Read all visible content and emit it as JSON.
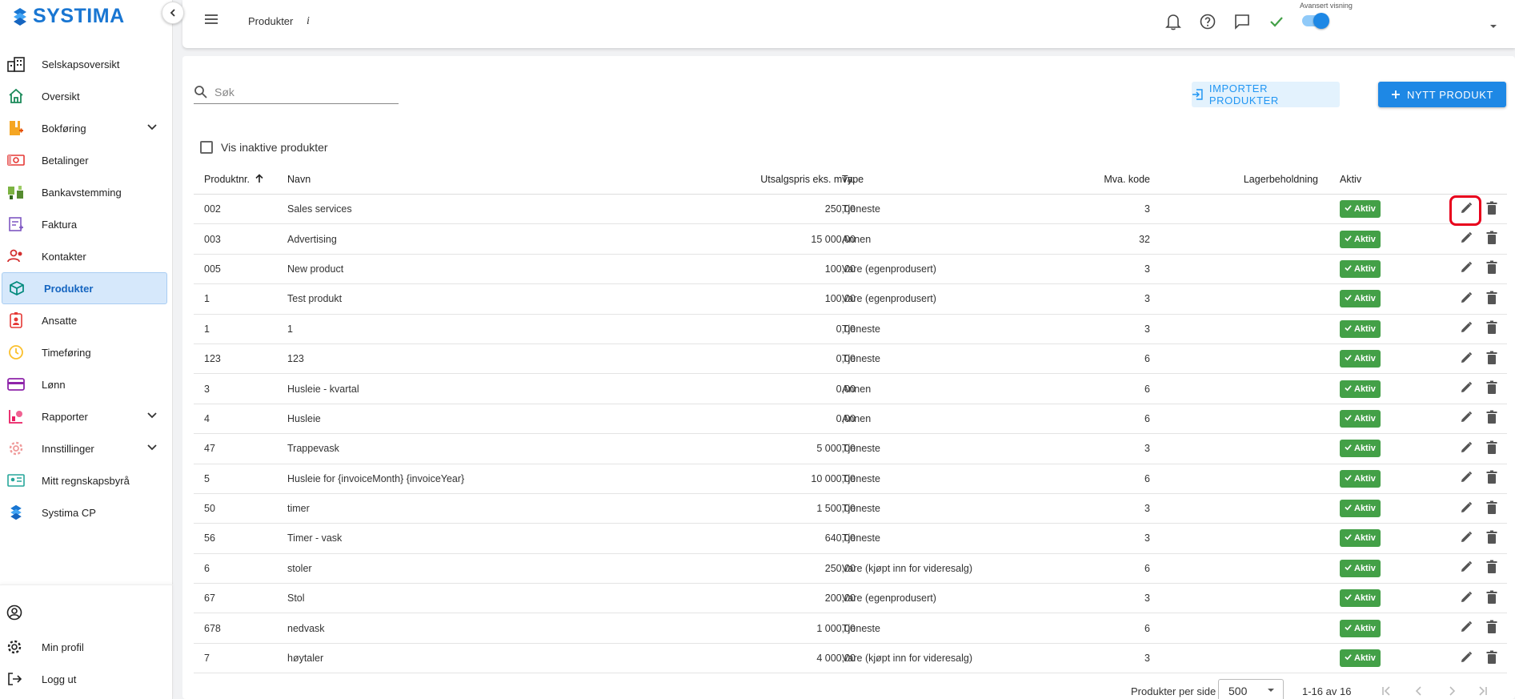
{
  "brand": {
    "name": "SYSTIMA",
    "color": "#1976d2"
  },
  "sidebar": {
    "items": [
      {
        "label": "Selskapsoversikt",
        "icon": "building-icon"
      },
      {
        "label": "Oversikt",
        "icon": "home-icon"
      },
      {
        "label": "Bokføring",
        "icon": "bookkeeping-icon",
        "expandable": true
      },
      {
        "label": "Betalinger",
        "icon": "payments-icon"
      },
      {
        "label": "Bankavstemming",
        "icon": "bank-reconciliation-icon"
      },
      {
        "label": "Faktura",
        "icon": "invoice-icon"
      },
      {
        "label": "Kontakter",
        "icon": "contacts-icon"
      },
      {
        "label": "Produkter",
        "icon": "product-box-icon",
        "active": true
      },
      {
        "label": "Ansatte",
        "icon": "employees-icon"
      },
      {
        "label": "Timeføring",
        "icon": "clock-icon"
      },
      {
        "label": "Lønn",
        "icon": "salary-card-icon"
      },
      {
        "label": "Rapporter",
        "icon": "reports-icon",
        "expandable": true
      },
      {
        "label": "Innstillinger",
        "icon": "settings-gear-icon",
        "expandable": true
      },
      {
        "label": "Mitt regnskapsbyrå",
        "icon": "accounting-firm-icon"
      },
      {
        "label": "Systima CP",
        "icon": "systima-logo-icon"
      }
    ],
    "bottom": {
      "profile_label": "Min profil",
      "logout_label": "Logg ut"
    }
  },
  "header": {
    "title": "Produkter",
    "info": "i",
    "advanced_view_label": "Avansert visning",
    "advanced_view_on": true
  },
  "toolbar": {
    "search_placeholder": "Søk",
    "import_label": "IMPORTER PRODUKTER",
    "new_label": "NYTT PRODUKT",
    "show_inactive_label": "Vis inaktive produkter",
    "show_inactive_checked": false
  },
  "table": {
    "headers": {
      "nr": "Produktnr.",
      "name": "Navn",
      "price": "Utsalgspris eks. mva.",
      "type": "Type",
      "mva": "Mva. kode",
      "stock": "Lagerbeholdning",
      "active": "Aktiv"
    },
    "active_badge": "Aktiv",
    "rows": [
      {
        "nr": "002",
        "name": "Sales services",
        "price": "250,00",
        "type": "Tjeneste",
        "mva": "3",
        "stock": "",
        "active": true
      },
      {
        "nr": "003",
        "name": "Advertising",
        "price": "15 000,00",
        "type": "Annen",
        "mva": "32",
        "stock": "",
        "active": true
      },
      {
        "nr": "005",
        "name": "New product",
        "price": "100,00",
        "type": "Vare (egenprodusert)",
        "mva": "3",
        "stock": "",
        "active": true
      },
      {
        "nr": "1",
        "name": "Test produkt",
        "price": "100,00",
        "type": "Vare (egenprodusert)",
        "mva": "3",
        "stock": "",
        "active": true
      },
      {
        "nr": "1",
        "name": "1",
        "price": "0,00",
        "type": "Tjeneste",
        "mva": "3",
        "stock": "",
        "active": true
      },
      {
        "nr": "123",
        "name": "123",
        "price": "0,00",
        "type": "Tjeneste",
        "mva": "6",
        "stock": "",
        "active": true
      },
      {
        "nr": "3",
        "name": "Husleie - kvartal",
        "price": "0,00",
        "type": "Annen",
        "mva": "6",
        "stock": "",
        "active": true
      },
      {
        "nr": "4",
        "name": "Husleie",
        "price": "0,00",
        "type": "Annen",
        "mva": "6",
        "stock": "",
        "active": true
      },
      {
        "nr": "47",
        "name": "Trappevask",
        "price": "5 000,00",
        "type": "Tjeneste",
        "mva": "3",
        "stock": "",
        "active": true
      },
      {
        "nr": "5",
        "name": "Husleie for {invoiceMonth} {invoiceYear}",
        "price": "10 000,00",
        "type": "Tjeneste",
        "mva": "6",
        "stock": "",
        "active": true
      },
      {
        "nr": "50",
        "name": "timer",
        "price": "1 500,00",
        "type": "Tjeneste",
        "mva": "3",
        "stock": "",
        "active": true
      },
      {
        "nr": "56",
        "name": "Timer - vask",
        "price": "640,00",
        "type": "Tjeneste",
        "mva": "3",
        "stock": "",
        "active": true
      },
      {
        "nr": "6",
        "name": "stoler",
        "price": "250,00",
        "type": "Vare (kjøpt inn for videresalg)",
        "mva": "6",
        "stock": "",
        "active": true
      },
      {
        "nr": "67",
        "name": "Stol",
        "price": "200,00",
        "type": "Vare (egenprodusert)",
        "mva": "3",
        "stock": "",
        "active": true
      },
      {
        "nr": "678",
        "name": "nedvask",
        "price": "1 000,00",
        "type": "Tjeneste",
        "mva": "6",
        "stock": "",
        "active": true
      },
      {
        "nr": "7",
        "name": "høytaler",
        "price": "4 000,00",
        "type": "Vare (kjøpt inn for videresalg)",
        "mva": "3",
        "stock": "",
        "active": true
      }
    ]
  },
  "pagination": {
    "per_page_label": "Produkter per side",
    "per_page_value": "500",
    "range": "1-16 av 16"
  },
  "colors": {
    "accent": "#1e88e5",
    "active_green": "#43a047",
    "highlight": "#e8001c"
  }
}
